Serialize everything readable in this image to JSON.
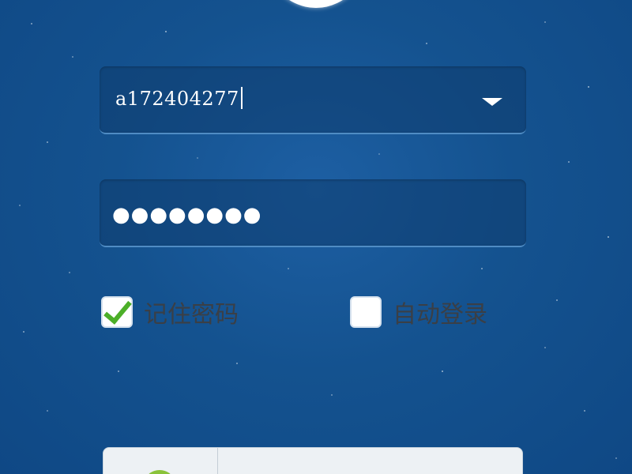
{
  "login_form": {
    "username": {
      "value": "a172404277",
      "dropdown_icon": "chevron-down-icon"
    },
    "password": {
      "masked_value": "●●●●●●●●"
    },
    "remember_password": {
      "label": "记住密码",
      "checked": true
    },
    "auto_login": {
      "label": "自动登录",
      "checked": false
    }
  },
  "colors": {
    "background": "#14528f",
    "check_green": "#4caf28",
    "field_underline": "#4f8cc4"
  }
}
